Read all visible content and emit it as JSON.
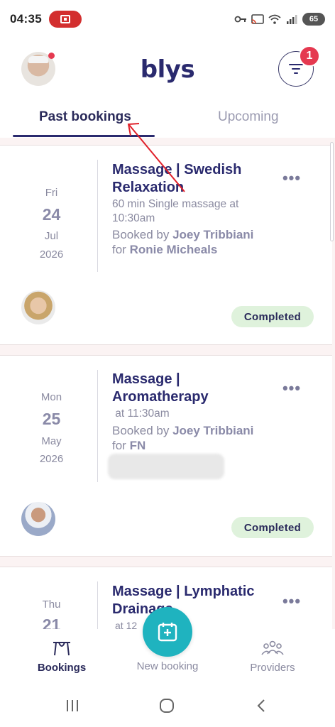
{
  "status_bar": {
    "time": "04:35",
    "battery": "65",
    "icons": [
      "screen-record-icon",
      "vpn-key-icon",
      "cast-icon",
      "wifi-icon",
      "signal-icon",
      "battery-icon"
    ]
  },
  "header": {
    "logo": "blys",
    "filter_badge_count": "1",
    "user_avatar_icon": "user-avatar",
    "filter_icon": "filter-lines-icon"
  },
  "tabs": {
    "past": "Past bookings",
    "upcoming": "Upcoming",
    "active": "past"
  },
  "bookings": [
    {
      "dow": "Fri",
      "day": "24",
      "month": "Jul",
      "year": "2026",
      "title": "Massage | Swedish Relaxation",
      "subtitle": "60 min Single massage at 10:30am",
      "booked_by_prefix": "Booked by",
      "booked_by": "Joey Tribbiani",
      "for_word": "for",
      "recipient": "Ronie Micheals",
      "status": "Completed"
    },
    {
      "dow": "Mon",
      "day": "25",
      "month": "May",
      "year": "2026",
      "title": "Massage | Aromatherapy",
      "subtitle": " at 11:30am",
      "booked_by_prefix": "Booked by",
      "booked_by": "Joey Tribbiani",
      "for_word": "for",
      "recipient": "FN",
      "status": "Completed"
    },
    {
      "dow": "Thu",
      "day": "21",
      "title": "Massage | Lymphatic Drainage",
      "subtitle": "at 12"
    }
  ],
  "bottom_nav": {
    "bookings": "Bookings",
    "new_booking": "New booking",
    "providers": "Providers"
  },
  "colors": {
    "brand": "#2a2a6e",
    "accent_teal": "#1fb3bf",
    "badge_red": "#e53950",
    "completed_bg": "#dff2dc",
    "annotation_arrow": "#e0202a"
  }
}
